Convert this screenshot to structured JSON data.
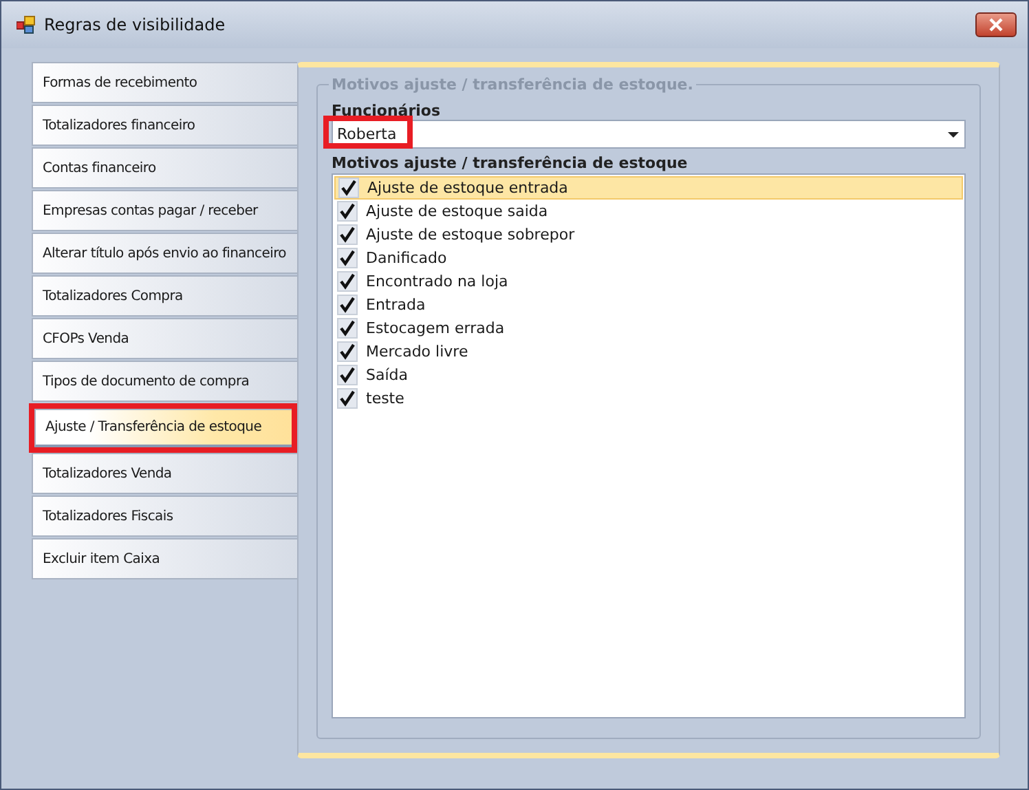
{
  "window": {
    "title": "Regras de visibilidade"
  },
  "tabs": [
    {
      "label": "Formas de recebimento",
      "selected": false,
      "highlighted": false
    },
    {
      "label": "Totalizadores financeiro",
      "selected": false,
      "highlighted": false
    },
    {
      "label": "Contas financeiro",
      "selected": false,
      "highlighted": false
    },
    {
      "label": "Empresas contas pagar / receber",
      "selected": false,
      "highlighted": false
    },
    {
      "label": "Alterar título após envio ao financeiro",
      "selected": false,
      "highlighted": false
    },
    {
      "label": "Totalizadores Compra",
      "selected": false,
      "highlighted": false
    },
    {
      "label": "CFOPs Venda",
      "selected": false,
      "highlighted": false
    },
    {
      "label": "Tipos de documento de compra",
      "selected": false,
      "highlighted": false
    },
    {
      "label": "Ajuste / Transferência de estoque",
      "selected": true,
      "highlighted": true
    },
    {
      "label": "Totalizadores Venda",
      "selected": false,
      "highlighted": false
    },
    {
      "label": "Totalizadores Fiscais",
      "selected": false,
      "highlighted": false
    },
    {
      "label": "Excluir item Caixa",
      "selected": false,
      "highlighted": false
    }
  ],
  "group": {
    "title": "Motivos ajuste / transferência de estoque.",
    "employee_label": "Funcionários",
    "employee": {
      "value": "Roberta",
      "highlighted": true
    },
    "reasons_label": "Motivos ajuste / transferência de estoque",
    "reasons": [
      {
        "label": "Ajuste de estoque entrada",
        "checked": true,
        "selected": true
      },
      {
        "label": "Ajuste de estoque saida",
        "checked": true,
        "selected": false
      },
      {
        "label": "Ajuste de estoque sobrepor",
        "checked": true,
        "selected": false
      },
      {
        "label": "Danificado",
        "checked": true,
        "selected": false
      },
      {
        "label": "Encontrado na loja",
        "checked": true,
        "selected": false
      },
      {
        "label": "Entrada",
        "checked": true,
        "selected": false
      },
      {
        "label": "Estocagem errada",
        "checked": true,
        "selected": false
      },
      {
        "label": "Mercado livre",
        "checked": true,
        "selected": false
      },
      {
        "label": "Saída",
        "checked": true,
        "selected": false
      },
      {
        "label": "teste",
        "checked": true,
        "selected": false
      }
    ]
  }
}
